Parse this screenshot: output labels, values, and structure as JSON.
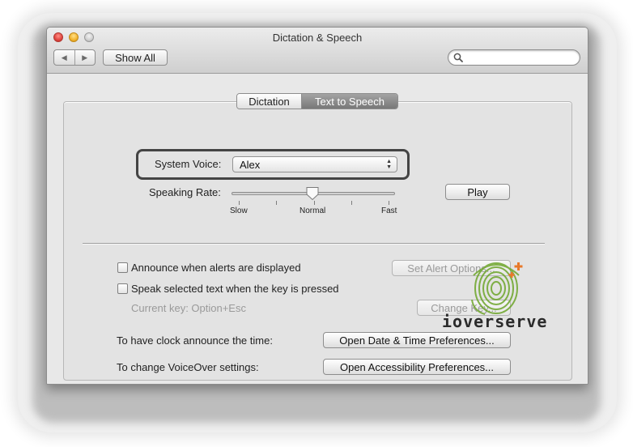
{
  "window": {
    "title": "Dictation & Speech"
  },
  "toolbar": {
    "back_label": "◀",
    "forward_label": "▶",
    "show_all_label": "Show All",
    "search_value": "",
    "search_placeholder": ""
  },
  "tabs": [
    {
      "label": "Dictation",
      "selected": false
    },
    {
      "label": "Text to Speech",
      "selected": true
    }
  ],
  "system_voice": {
    "label": "System Voice:",
    "selected": "Alex"
  },
  "speaking_rate": {
    "label": "Speaking Rate:",
    "slow_label": "Slow",
    "normal_label": "Normal",
    "fast_label": "Fast",
    "value_fraction": 0.5
  },
  "play_label": "Play",
  "announce_alerts": {
    "label": "Announce when alerts are displayed",
    "checked": false,
    "button": "Set Alert Options..."
  },
  "speak_selected": {
    "label": "Speak selected text when the key is pressed",
    "checked": false,
    "current_key": "Current key: Option+Esc",
    "button": "Change Key..."
  },
  "clock": {
    "label": "To have clock announce the time:",
    "button": "Open Date & Time Preferences..."
  },
  "voiceover": {
    "label": "To change VoiceOver settings:",
    "button": "Open Accessibility Preferences..."
  },
  "watermark": {
    "brand": "ioverserve"
  },
  "colors": {
    "selected_tab": "#8a8a8a",
    "highlight_border": "#444444",
    "watermark_green": "#6da52a",
    "watermark_orange": "#e8792a"
  }
}
